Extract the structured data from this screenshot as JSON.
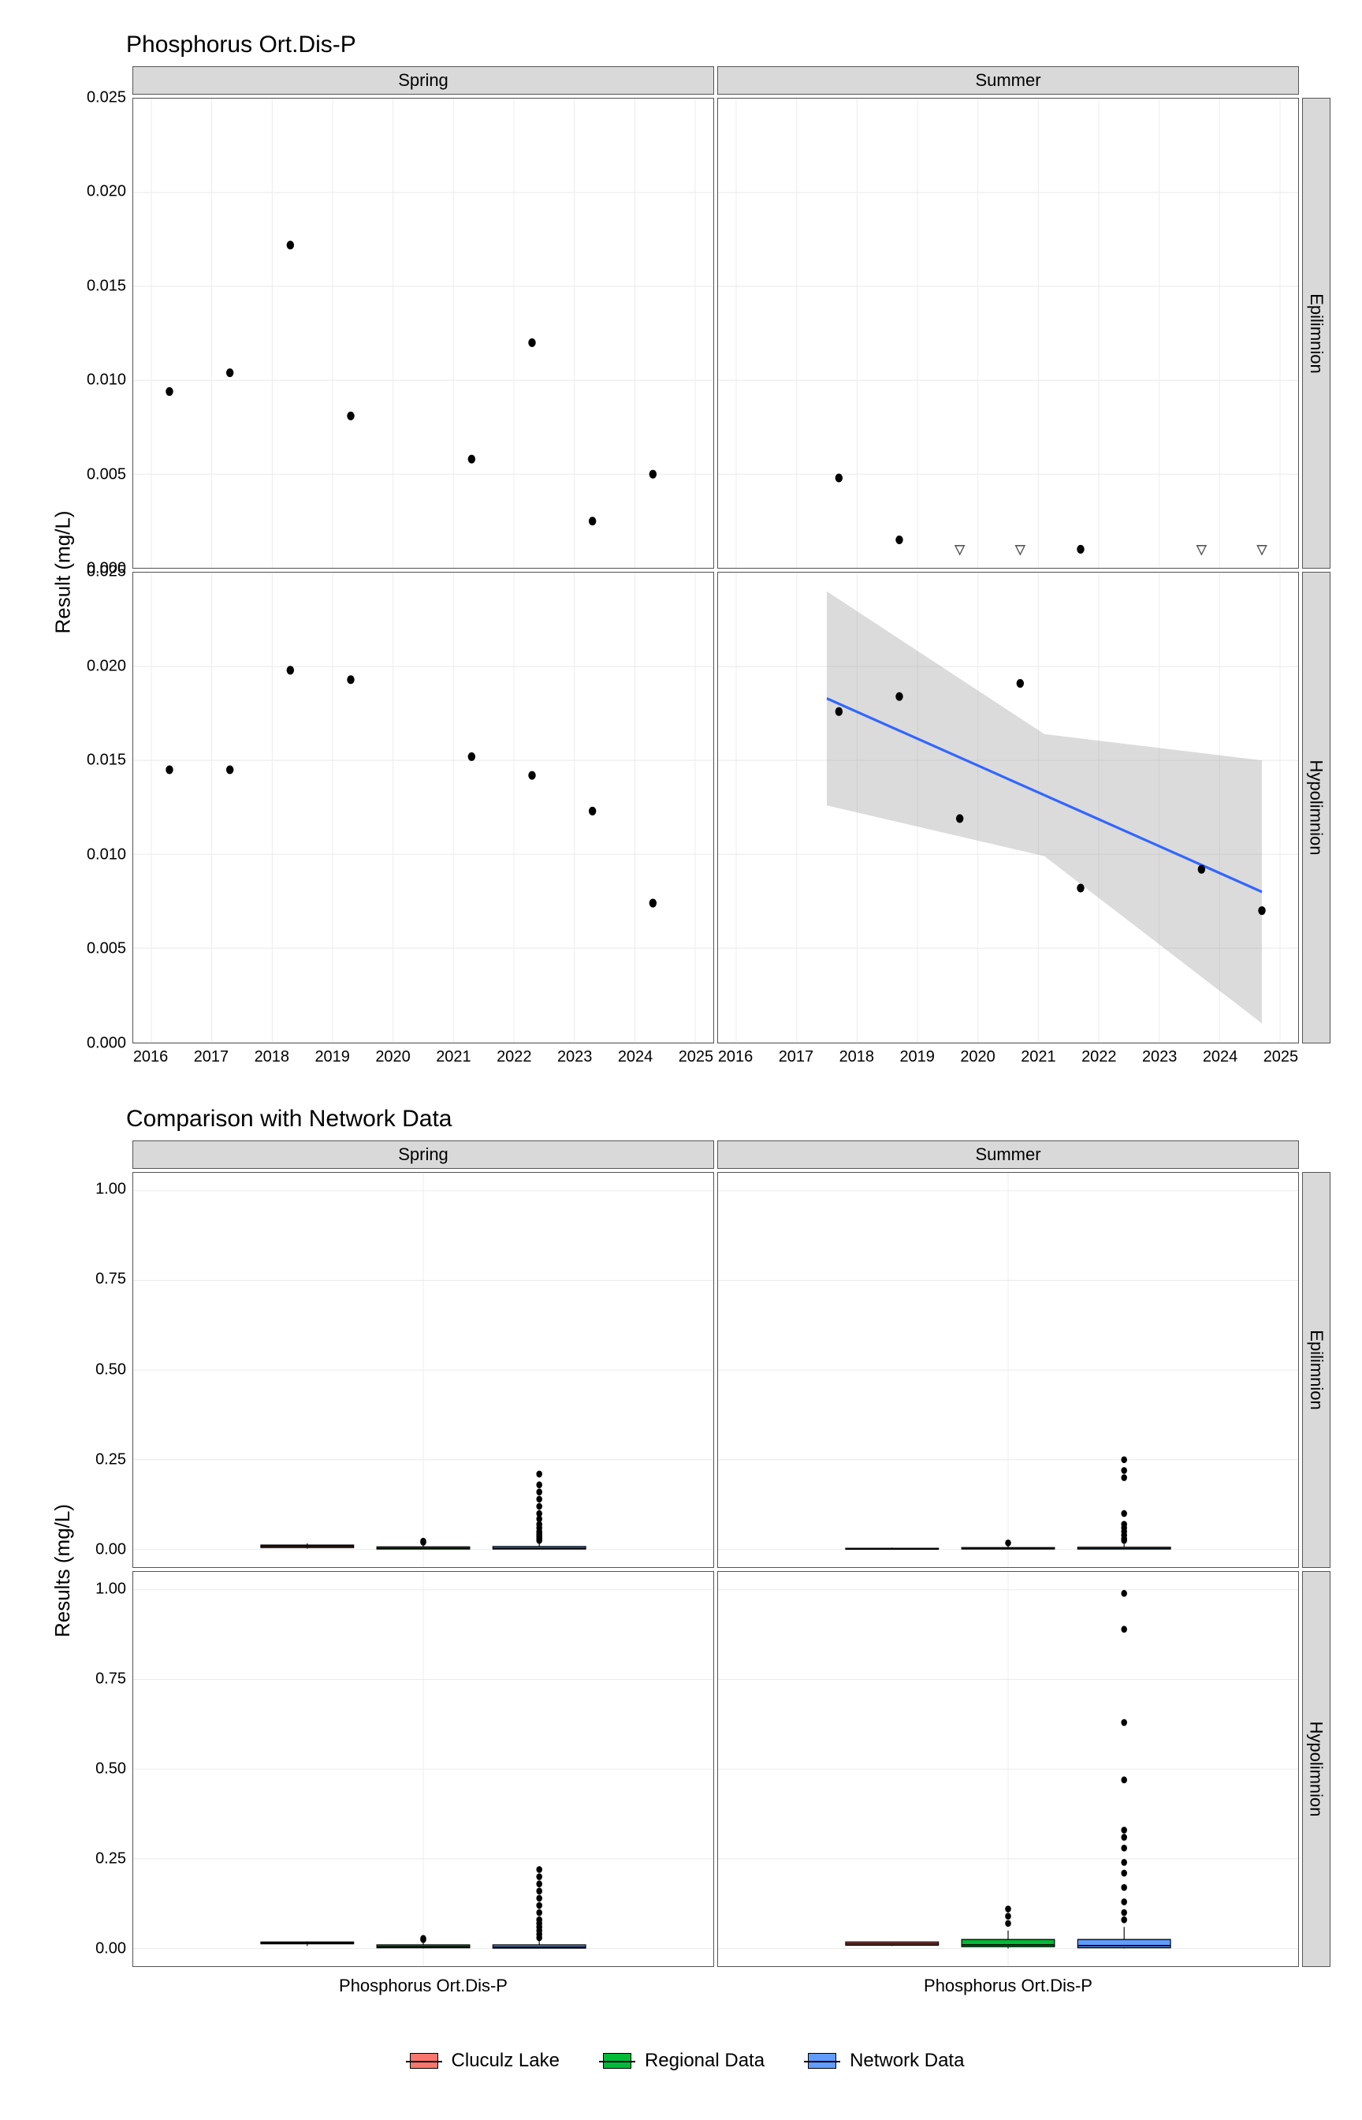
{
  "chart_data": [
    {
      "title": "Phosphorus Ort.Dis-P",
      "type": "scatter",
      "ylabel": "Result (mg/L)",
      "facets_cols": [
        "Spring",
        "Summer"
      ],
      "facets_rows": [
        "Epilimnion",
        "Hypolimnion"
      ],
      "xlim": [
        2015.7,
        2025.3
      ],
      "ylim": [
        0,
        0.025
      ],
      "xticks": [
        2016,
        2017,
        2018,
        2019,
        2020,
        2021,
        2022,
        2023,
        2024,
        2025
      ],
      "yticks": [
        0.0,
        0.005,
        0.01,
        0.015,
        0.02,
        0.025
      ],
      "panels": {
        "Spring|Epilimnion": {
          "points": [
            {
              "x": 2016.3,
              "y": 0.0094
            },
            {
              "x": 2017.3,
              "y": 0.0104
            },
            {
              "x": 2018.3,
              "y": 0.0172
            },
            {
              "x": 2019.3,
              "y": 0.0081
            },
            {
              "x": 2021.3,
              "y": 0.0058
            },
            {
              "x": 2022.3,
              "y": 0.012
            },
            {
              "x": 2023.3,
              "y": 0.0025
            },
            {
              "x": 2024.3,
              "y": 0.005
            }
          ],
          "open_triangles": []
        },
        "Summer|Epilimnion": {
          "points": [
            {
              "x": 2017.7,
              "y": 0.0048
            },
            {
              "x": 2018.7,
              "y": 0.0015
            },
            {
              "x": 2021.7,
              "y": 0.001
            }
          ],
          "open_triangles": [
            {
              "x": 2019.7,
              "y": 0.001
            },
            {
              "x": 2020.7,
              "y": 0.001
            },
            {
              "x": 2023.7,
              "y": 0.001
            },
            {
              "x": 2024.7,
              "y": 0.001
            }
          ]
        },
        "Spring|Hypolimnion": {
          "points": [
            {
              "x": 2016.3,
              "y": 0.0145
            },
            {
              "x": 2017.3,
              "y": 0.0145
            },
            {
              "x": 2018.3,
              "y": 0.0198
            },
            {
              "x": 2019.3,
              "y": 0.0193
            },
            {
              "x": 2021.3,
              "y": 0.0152
            },
            {
              "x": 2022.3,
              "y": 0.0142
            },
            {
              "x": 2023.3,
              "y": 0.0123
            },
            {
              "x": 2024.3,
              "y": 0.0074
            }
          ],
          "open_triangles": []
        },
        "Summer|Hypolimnion": {
          "points": [
            {
              "x": 2017.7,
              "y": 0.0176
            },
            {
              "x": 2018.7,
              "y": 0.0184
            },
            {
              "x": 2019.7,
              "y": 0.0119
            },
            {
              "x": 2020.7,
              "y": 0.0191
            },
            {
              "x": 2021.7,
              "y": 0.0082
            },
            {
              "x": 2023.7,
              "y": 0.0092
            },
            {
              "x": 2024.7,
              "y": 0.007
            }
          ],
          "open_triangles": [],
          "trend": {
            "x1": 2017.5,
            "y1": 0.0183,
            "x2": 2024.7,
            "y2": 0.008
          },
          "ribbon": [
            {
              "x": 2017.5,
              "lo": 0.0126,
              "hi": 0.024
            },
            {
              "x": 2021.1,
              "lo": 0.0099,
              "hi": 0.0164
            },
            {
              "x": 2024.7,
              "lo": 0.001,
              "hi": 0.015
            }
          ]
        }
      }
    },
    {
      "title": "Comparison with Network Data",
      "type": "box",
      "ylabel": "Results (mg/L)",
      "facets_cols": [
        "Spring",
        "Summer"
      ],
      "facets_rows": [
        "Epilimnion",
        "Hypolimnion"
      ],
      "xcat": "Phosphorus Ort.Dis-P",
      "ylim": [
        -0.05,
        1.05
      ],
      "yticks": [
        0.0,
        0.25,
        0.5,
        0.75,
        1.0
      ],
      "series": [
        "Cluculz Lake",
        "Regional Data",
        "Network Data"
      ],
      "colors": {
        "Cluculz Lake": "#F8766D",
        "Regional Data": "#00BA38",
        "Network Data": "#619CFF"
      },
      "panels": {
        "Spring|Epilimnion": {
          "boxes": [
            {
              "series": "Cluculz Lake",
              "min": 0.002,
              "q1": 0.005,
              "med": 0.009,
              "q3": 0.012,
              "max": 0.017,
              "outliers": []
            },
            {
              "series": "Regional Data",
              "min": 0.0,
              "q1": 0.001,
              "med": 0.003,
              "q3": 0.007,
              "max": 0.015,
              "outliers": [
                0.02,
                0.023
              ]
            },
            {
              "series": "Network Data",
              "min": 0.0,
              "q1": 0.001,
              "med": 0.003,
              "q3": 0.008,
              "max": 0.018,
              "outliers": [
                0.025,
                0.03,
                0.035,
                0.04,
                0.045,
                0.05,
                0.06,
                0.07,
                0.085,
                0.1,
                0.12,
                0.14,
                0.16,
                0.18,
                0.21
              ]
            }
          ]
        },
        "Summer|Epilimnion": {
          "boxes": [
            {
              "series": "Cluculz Lake",
              "min": 0.001,
              "q1": 0.001,
              "med": 0.001,
              "q3": 0.003,
              "max": 0.005,
              "outliers": []
            },
            {
              "series": "Regional Data",
              "min": 0.0,
              "q1": 0.001,
              "med": 0.002,
              "q3": 0.005,
              "max": 0.012,
              "outliers": [
                0.018
              ]
            },
            {
              "series": "Network Data",
              "min": 0.0,
              "q1": 0.001,
              "med": 0.002,
              "q3": 0.006,
              "max": 0.015,
              "outliers": [
                0.025,
                0.03,
                0.04,
                0.05,
                0.06,
                0.07,
                0.1,
                0.2,
                0.22,
                0.25
              ]
            }
          ]
        },
        "Spring|Hypolimnion": {
          "boxes": [
            {
              "series": "Cluculz Lake",
              "min": 0.007,
              "q1": 0.013,
              "med": 0.015,
              "q3": 0.018,
              "max": 0.02,
              "outliers": []
            },
            {
              "series": "Regional Data",
              "min": 0.0,
              "q1": 0.002,
              "med": 0.005,
              "q3": 0.01,
              "max": 0.02,
              "outliers": [
                0.025,
                0.028
              ]
            },
            {
              "series": "Network Data",
              "min": 0.0,
              "q1": 0.001,
              "med": 0.004,
              "q3": 0.01,
              "max": 0.022,
              "outliers": [
                0.03,
                0.04,
                0.05,
                0.06,
                0.07,
                0.08,
                0.1,
                0.12,
                0.14,
                0.16,
                0.18,
                0.2,
                0.22
              ]
            }
          ]
        },
        "Summer|Hypolimnion": {
          "boxes": [
            {
              "series": "Cluculz Lake",
              "min": 0.007,
              "q1": 0.009,
              "med": 0.013,
              "q3": 0.018,
              "max": 0.019,
              "outliers": []
            },
            {
              "series": "Regional Data",
              "min": 0.0,
              "q1": 0.005,
              "med": 0.01,
              "q3": 0.025,
              "max": 0.05,
              "outliers": [
                0.07,
                0.09,
                0.11
              ]
            },
            {
              "series": "Network Data",
              "min": 0.0,
              "q1": 0.002,
              "med": 0.008,
              "q3": 0.025,
              "max": 0.06,
              "outliers": [
                0.08,
                0.1,
                0.13,
                0.17,
                0.21,
                0.24,
                0.28,
                0.31,
                0.33,
                0.47,
                0.63,
                0.89,
                0.99
              ]
            }
          ]
        }
      }
    }
  ],
  "legend": [
    "Cluculz Lake",
    "Regional Data",
    "Network Data"
  ]
}
